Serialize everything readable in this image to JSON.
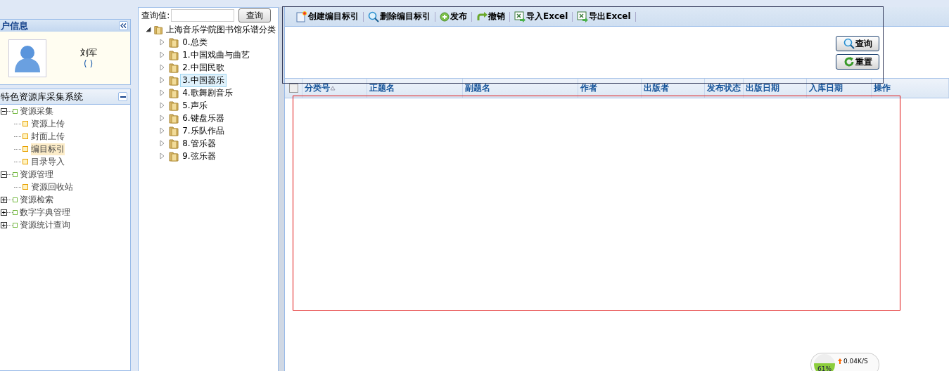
{
  "user_panel": {
    "title": "户信息",
    "user_name": "刘军",
    "user_role": "( )"
  },
  "nav_panel": {
    "title": "特色资源库采集系统",
    "items": [
      {
        "label": "资源采集",
        "expanded": true,
        "children": [
          {
            "label": "资源上传",
            "selected": false
          },
          {
            "label": "封面上传",
            "selected": false
          },
          {
            "label": "编目标引",
            "selected": true
          },
          {
            "label": "目录导入",
            "selected": false
          }
        ]
      },
      {
        "label": "资源管理",
        "expanded": true,
        "children": [
          {
            "label": "资源回收站",
            "selected": false
          }
        ]
      },
      {
        "label": "资源检索",
        "expanded": false
      },
      {
        "label": "数字字典管理",
        "expanded": false
      },
      {
        "label": "资源统计查询",
        "expanded": false
      }
    ]
  },
  "category_panel": {
    "search_label": "查询值:",
    "search_button": "查询",
    "tree": {
      "label": "上海音乐学院图书馆乐谱分类",
      "expanded": true,
      "children": [
        {
          "label": "0.总类",
          "selected": false
        },
        {
          "label": "1.中国戏曲与曲艺",
          "selected": false
        },
        {
          "label": "2.中国民歌",
          "selected": false
        },
        {
          "label": "3.中国器乐",
          "selected": true
        },
        {
          "label": "4.歌舞剧音乐",
          "selected": false
        },
        {
          "label": "5.声乐",
          "selected": false
        },
        {
          "label": "6.键盘乐器",
          "selected": false
        },
        {
          "label": "7.乐队作品",
          "selected": false
        },
        {
          "label": "8.管乐器",
          "selected": false
        },
        {
          "label": "9.弦乐器",
          "selected": false
        }
      ]
    }
  },
  "toolbar": [
    {
      "kind": "create",
      "label": "创建编目标引"
    },
    {
      "kind": "delete",
      "label": "删除编目标引"
    },
    {
      "kind": "publish",
      "label": "发布"
    },
    {
      "kind": "undo",
      "label": "撤销"
    },
    {
      "kind": "import",
      "label": "导入Excel"
    },
    {
      "kind": "export",
      "label": "导出Excel"
    }
  ],
  "form_buttons": [
    {
      "kind": "search",
      "label": "查询"
    },
    {
      "kind": "reset",
      "label": "重置"
    }
  ],
  "table": {
    "select_all_checked": false,
    "columns": [
      {
        "label": "分类号",
        "sorted": true
      },
      {
        "label": "正题名",
        "sorted": false
      },
      {
        "label": "副题名",
        "sorted": false
      },
      {
        "label": "作者",
        "sorted": false
      },
      {
        "label": "出版者",
        "sorted": false
      },
      {
        "label": "发布状态",
        "sorted": false
      },
      {
        "label": "出版日期",
        "sorted": false
      },
      {
        "label": "入库日期",
        "sorted": false
      },
      {
        "label": "操作",
        "sorted": false
      }
    ]
  },
  "speed_widget": {
    "percent": "61%",
    "upload": "0.04K/S"
  }
}
